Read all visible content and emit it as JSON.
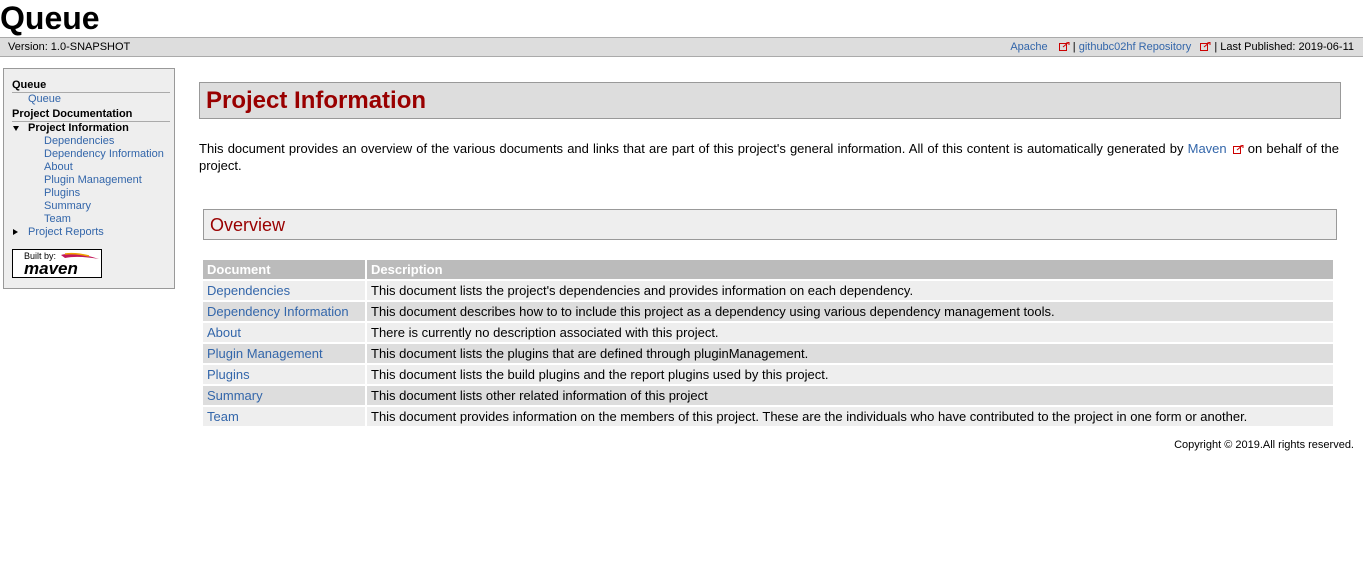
{
  "site": {
    "title": "Queue"
  },
  "breadcrumbs": {
    "version": "Version: 1.0-SNAPSHOT",
    "links": [
      "Apache",
      "githubc02hf Repository"
    ],
    "separator": "|",
    "last_published": "Last Published: 2019-06-11"
  },
  "sidebar": {
    "section1": {
      "title": "Queue",
      "items": [
        "Queue"
      ]
    },
    "section2": {
      "title": "Project Documentation",
      "expanded": {
        "label": "Project Information",
        "children": [
          "Dependencies",
          "Dependency Information",
          "About",
          "Plugin Management",
          "Plugins",
          "Summary",
          "Team"
        ]
      },
      "collapsed": {
        "label": "Project Reports"
      }
    },
    "built_by": {
      "label": "Built by:",
      "logo": "maven"
    }
  },
  "main": {
    "heading": "Project Information",
    "intro_before": "This document provides an overview of the various documents and links that are part of this project's general information. All of this content is automatically generated by ",
    "intro_link": "Maven",
    "intro_after": " on behalf of the project.",
    "overview_heading": "Overview",
    "table": {
      "headers": [
        "Document",
        "Description"
      ],
      "rows": [
        {
          "document": "Dependencies",
          "description": "This document lists the project's dependencies and provides information on each dependency."
        },
        {
          "document": "Dependency Information",
          "description": "This document describes how to to include this project as a dependency using various dependency management tools."
        },
        {
          "document": "About",
          "description": "There is currently no description associated with this project."
        },
        {
          "document": "Plugin Management",
          "description": "This document lists the plugins that are defined through pluginManagement."
        },
        {
          "document": "Plugins",
          "description": "This document lists the build plugins and the report plugins used by this project."
        },
        {
          "document": "Summary",
          "description": "This document lists other related information of this project"
        },
        {
          "document": "Team",
          "description": "This document provides information on the members of this project. These are the individuals who have contributed to the project in one form or another."
        }
      ]
    }
  },
  "footer": {
    "copyright": "Copyright © 2019.All rights reserved."
  },
  "colors": {
    "heading_red": "#990000",
    "link_blue": "#3366aa",
    "bar_gray": "#dddddd",
    "table_header": "#bbbbbb"
  }
}
